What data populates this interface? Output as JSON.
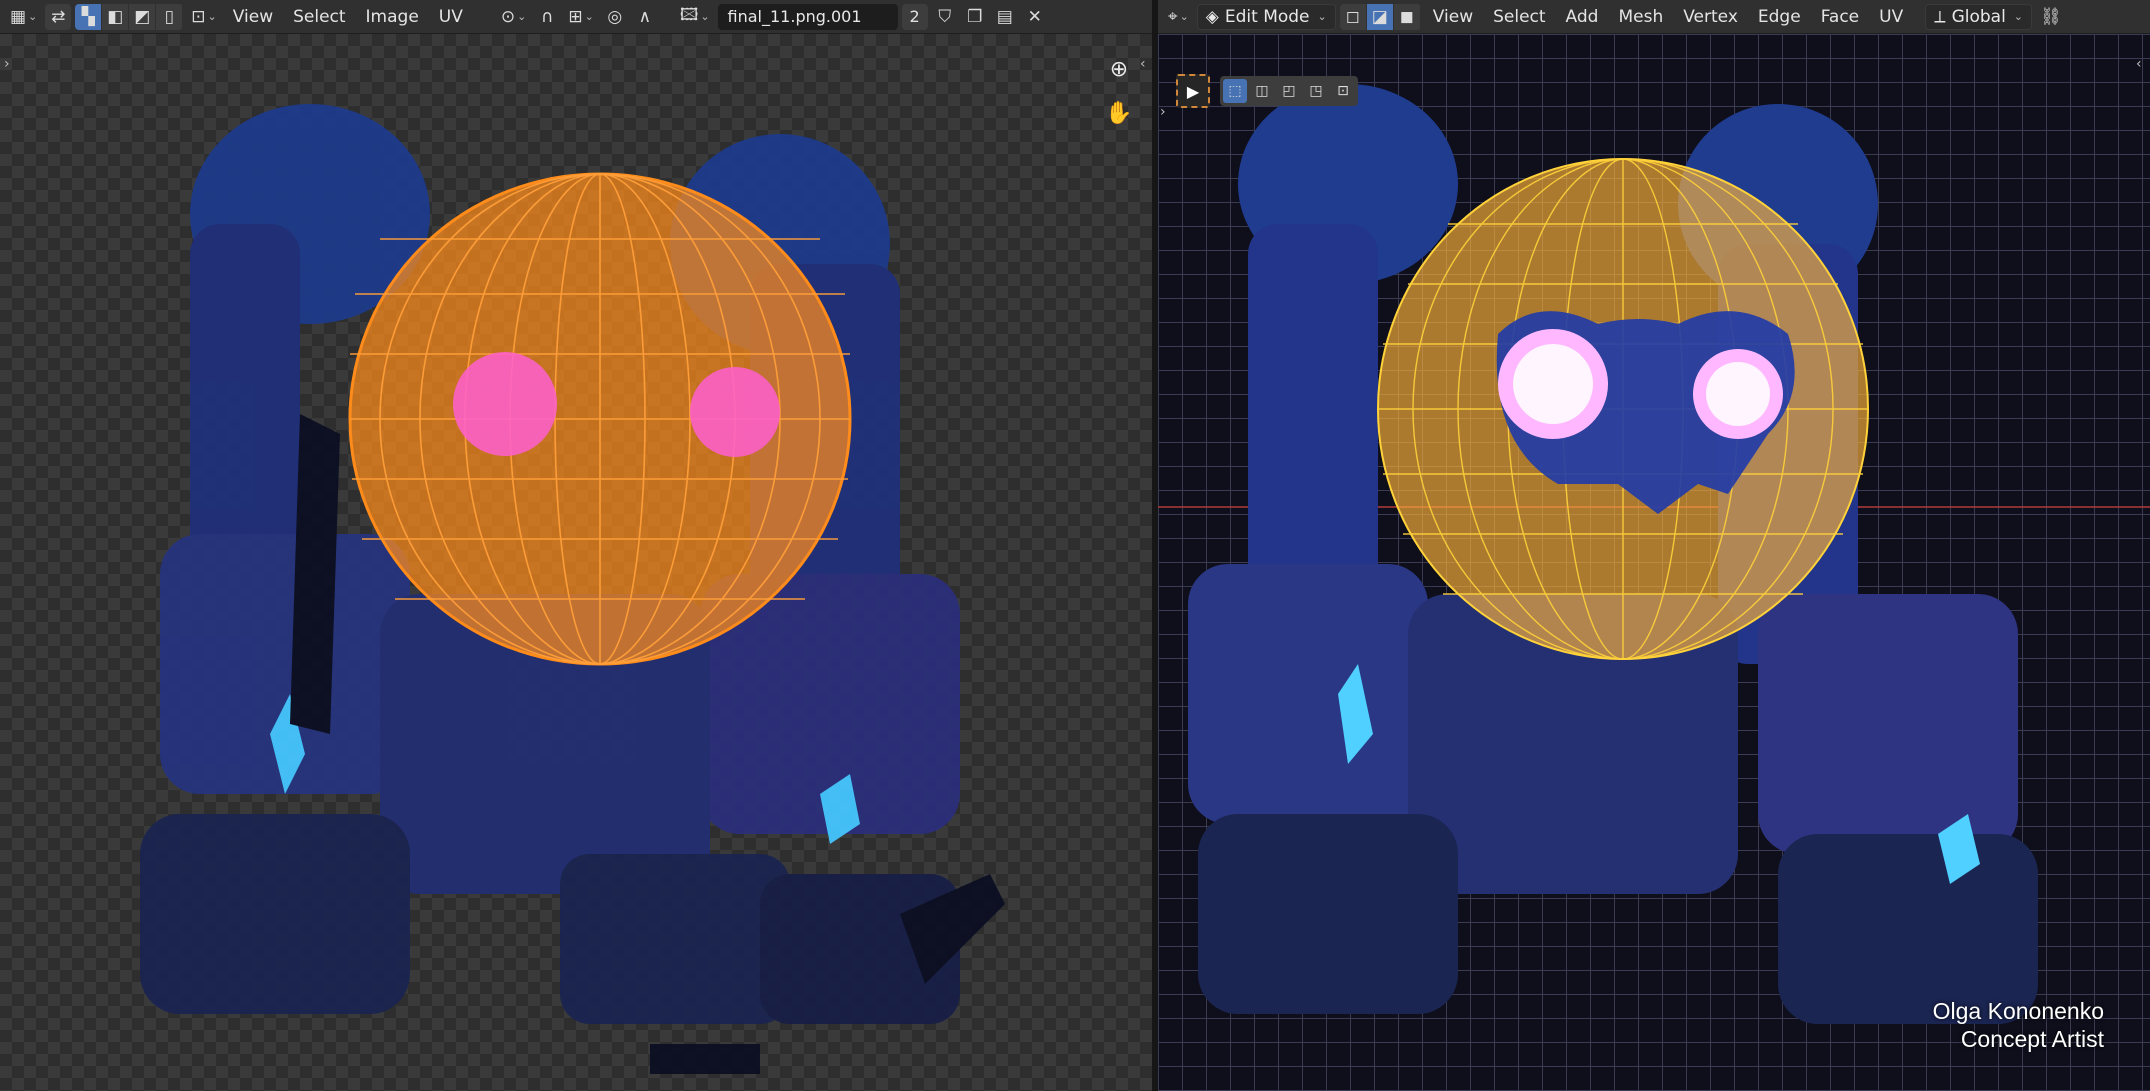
{
  "uv_editor": {
    "header": {
      "editor_type_icon": "uv-editor-icon",
      "menus": [
        "View",
        "Select",
        "Image",
        "UV"
      ],
      "image_name": "final_11.png.001",
      "image_users": "2"
    },
    "icons": {
      "zoom": "zoom-in-icon",
      "pan": "hand-pan-icon"
    },
    "accent_colors": {
      "uv_mesh": "#ff8c1a",
      "eyes": "#ff5fd0"
    }
  },
  "viewport": {
    "header": {
      "mode": "Edit Mode",
      "menus": [
        "View",
        "Select",
        "Add",
        "Mesh",
        "Vertex",
        "Edge",
        "Face",
        "UV"
      ],
      "orientation": "Global"
    },
    "overlay": {
      "name": "Olga Kononenko",
      "role": "Concept Artist"
    },
    "accent_colors": {
      "wireframe": "#ffd23a",
      "eyes": "#ffb8ff"
    }
  }
}
